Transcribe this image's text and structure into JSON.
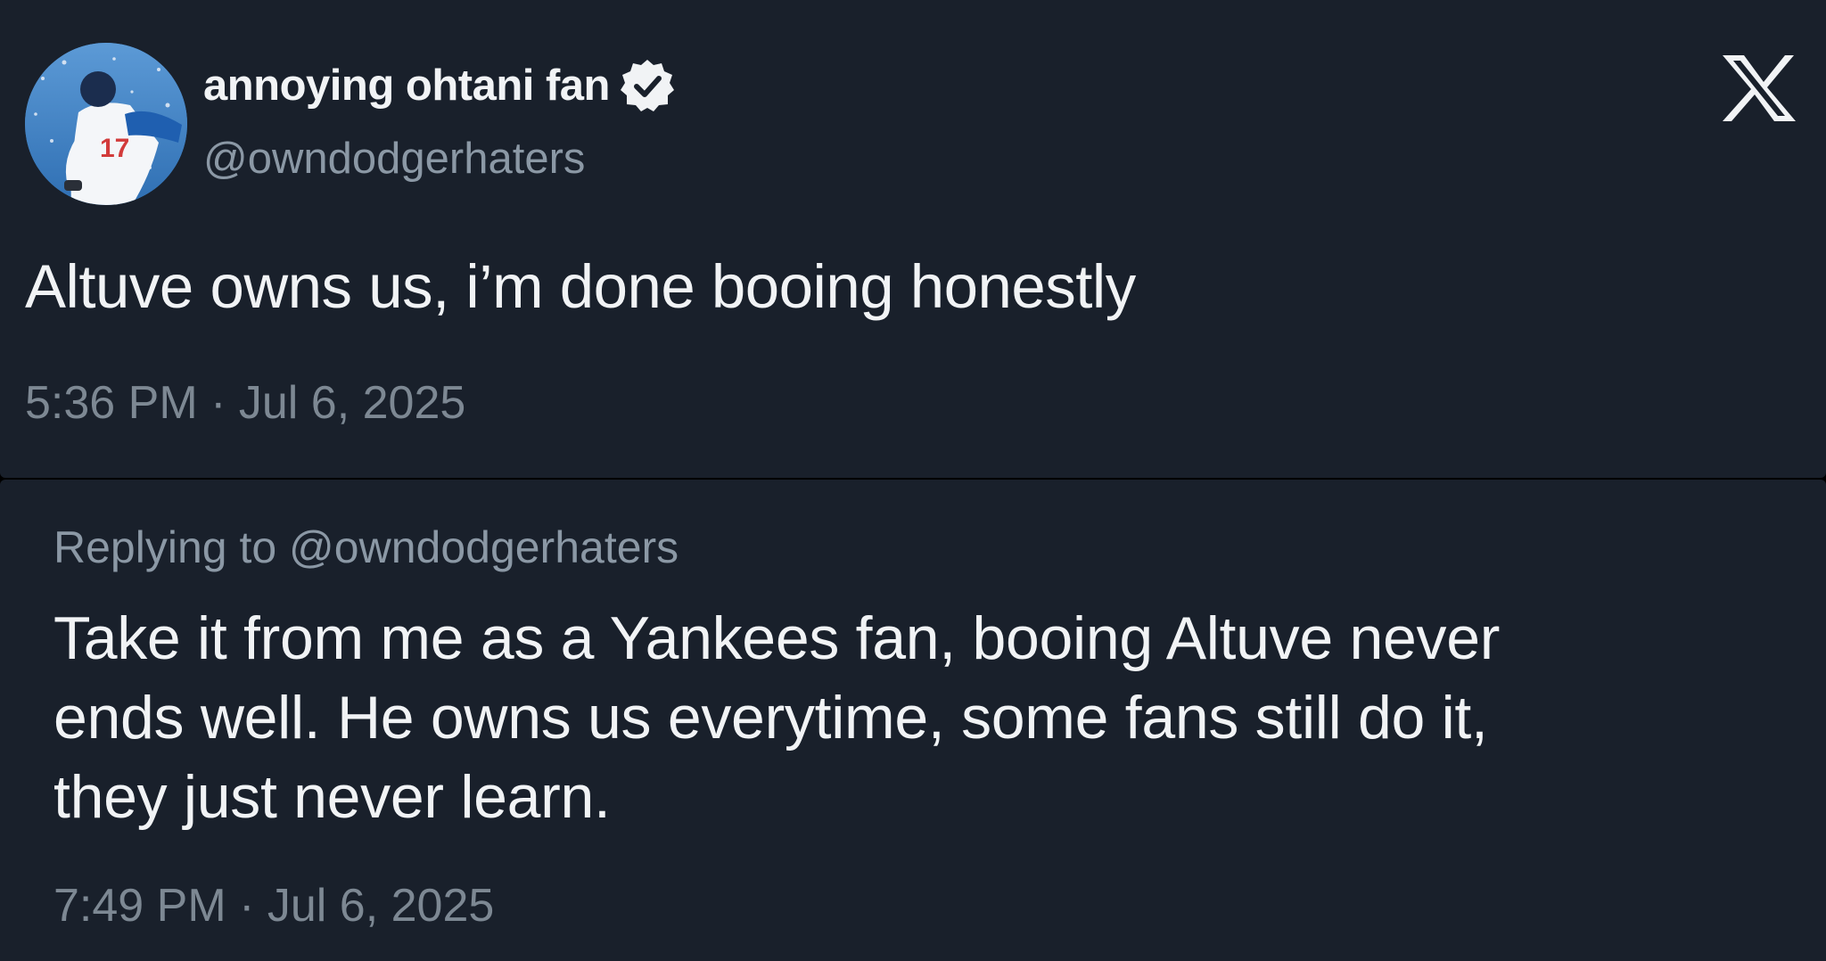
{
  "tweet": {
    "display_name": "annoying ohtani fan",
    "handle": "@owndodgerhaters",
    "text": "Altuve owns us, i’m done booing honestly",
    "timestamp": "5:36 PM · Jul 6, 2025",
    "verified": true
  },
  "reply": {
    "replying_to": "Replying to @owndodgerhaters",
    "lines": [
      "Take it from me as a Yankees fan, booing Altuve never",
      "ends well. He owns us everytime, some fans still do it,",
      "they just never learn."
    ],
    "timestamp": "7:49 PM · Jul 6, 2025"
  },
  "icons": {
    "platform_logo": "x-logo-icon",
    "verified": "verified-badge-icon"
  },
  "colors": {
    "card_background": "#19202b",
    "primary_text": "#f1f3f5",
    "secondary_text": "#8b98a5",
    "page_background": "#000000"
  }
}
